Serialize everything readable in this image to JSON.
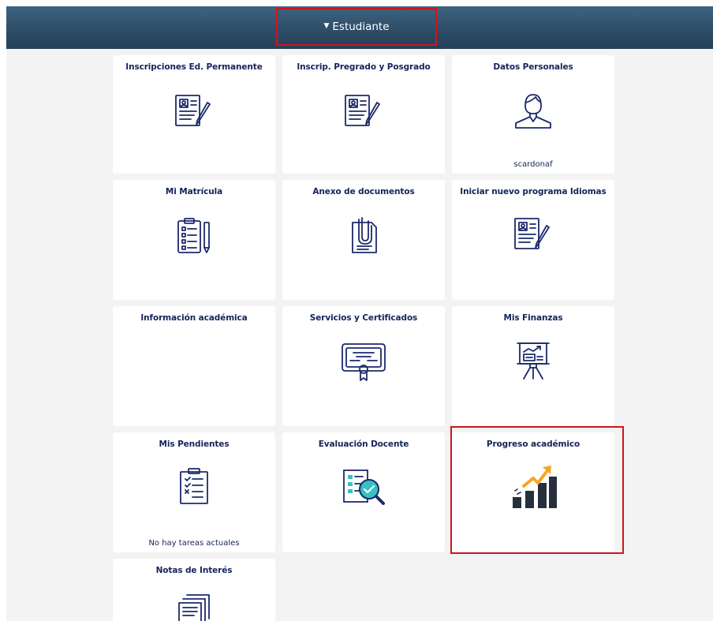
{
  "header": {
    "toggle_label": "Estudiante"
  },
  "tiles": [
    {
      "title": "Inscripciones Ed. Permanente",
      "icon": "form-pencil-icon"
    },
    {
      "title": "Inscrip. Pregrado y Posgrado",
      "icon": "form-pencil-icon"
    },
    {
      "title": "Datos Personales",
      "icon": "user-profile-icon",
      "footer": "scardonaf"
    },
    {
      "title": "Mi Matrícula",
      "icon": "clipboard-list-pen-icon"
    },
    {
      "title": "Anexo de documentos",
      "icon": "paperclip-document-icon"
    },
    {
      "title": "Iniciar nuevo programa Idiomas",
      "icon": "form-pencil-icon"
    },
    {
      "title": "Información académica"
    },
    {
      "title": "Servicios y Certificados",
      "icon": "certificate-icon"
    },
    {
      "title": "Mis Finanzas",
      "icon": "presentation-board-icon"
    },
    {
      "title": "Mis Pendientes",
      "icon": "checklist-icon",
      "footer": "No hay tareas actuales"
    },
    {
      "title": "Evaluación Docente",
      "icon": "evaluation-magnifier-icon"
    },
    {
      "title": "Progreso académico",
      "icon": "growth-chart-icon"
    },
    {
      "title": "Notas de Interés",
      "icon": "stacked-documents-icon"
    }
  ],
  "colors": {
    "header": "#2c4c66",
    "title_text": "#14245a",
    "highlight": "#d0141b",
    "accent_orange": "#f5a623",
    "accent_teal": "#35c2c4"
  }
}
